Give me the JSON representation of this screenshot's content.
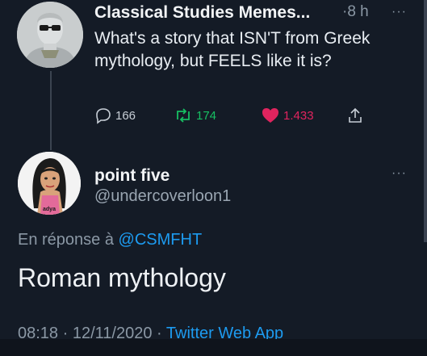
{
  "tweet1": {
    "author": "Classical Studies Memes...",
    "time": "·8 h",
    "text": "What's a story that ISN'T from Greek mythology, but FEELS like it is?",
    "replies": "166",
    "retweets": "174",
    "likes": "1.433",
    "more": "···"
  },
  "tweet2": {
    "author": "point five",
    "handle": "@undercoverloon1",
    "more": "···",
    "avatar_caption": "adya"
  },
  "reply_prefix": "En réponse à",
  "reply_mention": "@CSMFHT",
  "main_text": "Roman mythology",
  "footer": {
    "time": "08:18",
    "date": "12/11/2020",
    "sep": "·",
    "app": "Twitter Web App"
  },
  "colors": {
    "background": "#141b26",
    "link": "#1d9bf0",
    "retweet": "#17bf63",
    "like": "#e0245e"
  }
}
